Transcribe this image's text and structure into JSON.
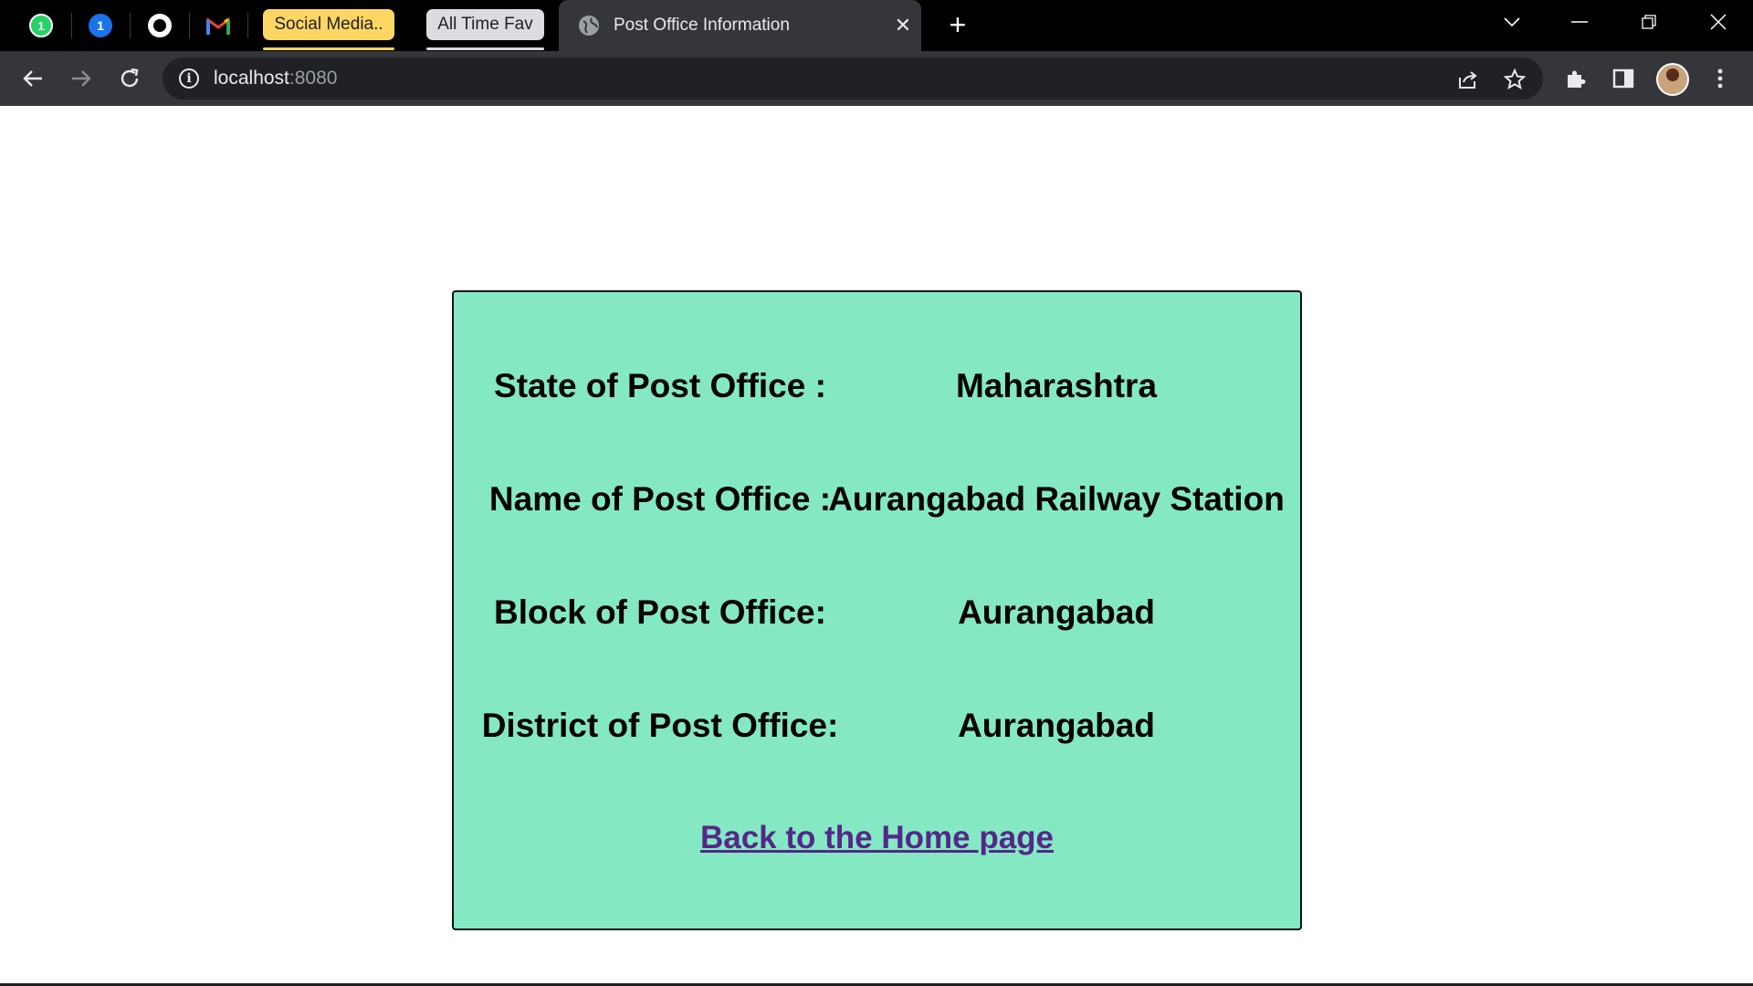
{
  "browser": {
    "pinned_tabs": [
      {
        "icon": "whatsapp-icon",
        "badge": "1"
      },
      {
        "icon": "password-manager-icon",
        "badge": "1"
      },
      {
        "icon": "github-icon"
      },
      {
        "icon": "gmail-icon"
      }
    ],
    "tab_groups": [
      {
        "label": "Social Media..",
        "color": "#fdd663"
      },
      {
        "label": "All Time Fav",
        "color": "#dadce0"
      }
    ],
    "active_tab": {
      "title": "Post Office Information",
      "icon": "globe-icon"
    },
    "new_tab_label": "+",
    "address": {
      "host": "localhost",
      "port": ":8080"
    }
  },
  "page": {
    "rows": [
      {
        "label": "State of Post Office :",
        "value": "Maharashtra"
      },
      {
        "label": "Name of Post Office :",
        "value": "Aurangabad Railway Station"
      },
      {
        "label": "Block of Post Office:",
        "value": "Aurangabad"
      },
      {
        "label": "District of Post Office:",
        "value": "Aurangabad"
      }
    ],
    "back_link": "Back to the Home page",
    "colors": {
      "card_background": "#84e9c3",
      "link": "#55278a"
    }
  }
}
